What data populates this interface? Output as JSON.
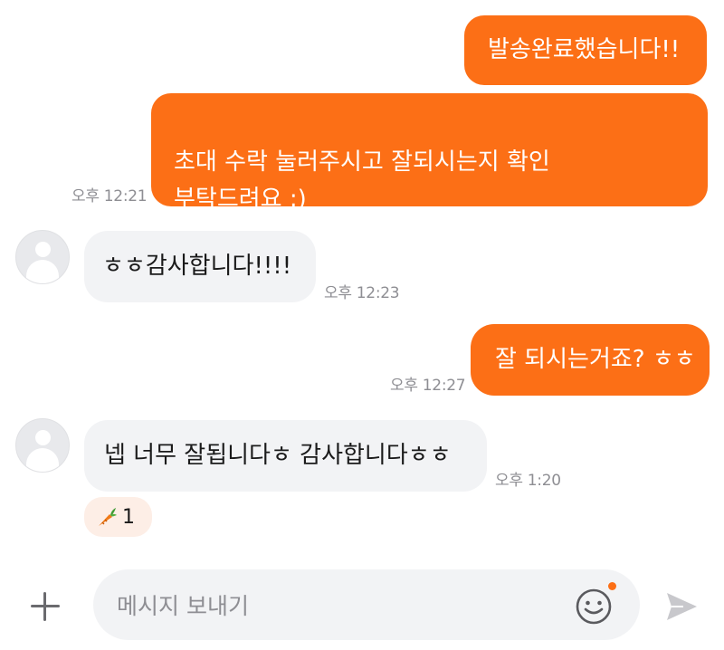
{
  "messages": [
    {
      "direction": "out",
      "text": "발송완료했습니다!!",
      "time": ""
    },
    {
      "direction": "out",
      "text": "초대 수락 눌러주시고 잘되시는지 확인\n부탁드려요 :)",
      "time": "오후 12:21"
    },
    {
      "direction": "in",
      "text": "ㅎㅎ감사합니다!!!!",
      "time": "오후 12:23"
    },
    {
      "direction": "out",
      "text": "잘 되시는거죠? ㅎㅎ",
      "time": "오후 12:27"
    },
    {
      "direction": "in",
      "text": "넵 너무 잘됩니다ㅎ 감사합니다ㅎㅎ",
      "time": "오후 1:20"
    }
  ],
  "reaction": {
    "icon": "carrot-icon",
    "count": "1"
  },
  "composer": {
    "placeholder": "메시지 보내기",
    "value": ""
  },
  "icons": {
    "add": "plus-icon",
    "emoji": "smiley-icon",
    "send": "paper-plane-icon",
    "avatar": "default-profile-icon"
  },
  "colors": {
    "outgoing_bubble": "#fc6f16",
    "incoming_bubble": "#f2f3f5",
    "timestamp": "#8e8e93",
    "notification_dot": "#fc6f16"
  }
}
